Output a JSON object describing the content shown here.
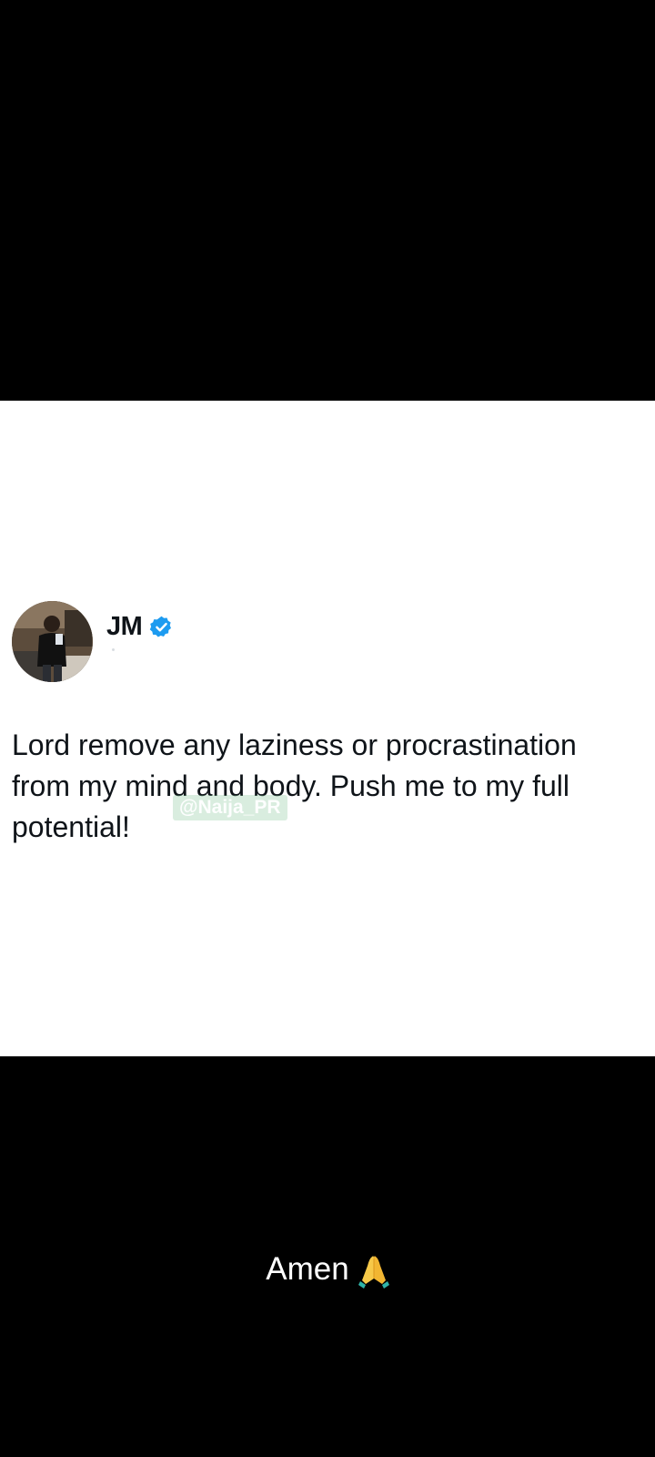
{
  "tweet": {
    "author_name": "JM",
    "verified": true,
    "text": "Lord remove any laziness or procrastination from my mind and body. Push me to my full potential!",
    "watermark": "@Naija_PR"
  },
  "caption": {
    "text": "Amen",
    "emoji_icon": "praying-hands-icon"
  },
  "colors": {
    "background": "#000000",
    "card": "#ffffff",
    "text": "#0f1419",
    "verified_badge": "#1d9bf0"
  }
}
